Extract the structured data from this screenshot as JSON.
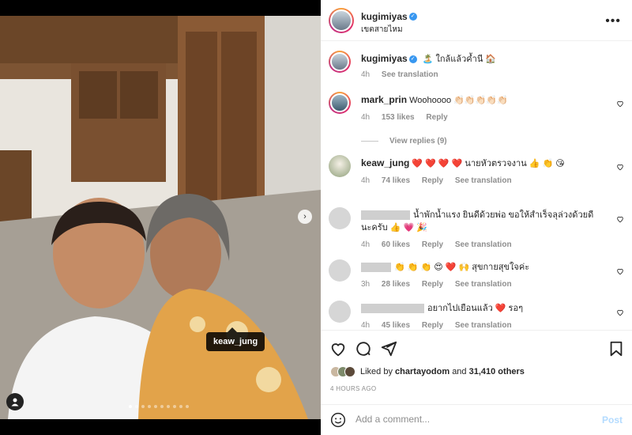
{
  "header": {
    "username": "kugimiyas",
    "location": "เขตสายไหม"
  },
  "caption": {
    "username": "kugimiyas",
    "text": "🏝️ ใกล้แล้วค้ำนี 🏠",
    "time": "4h",
    "translate": "See translation"
  },
  "comments": [
    {
      "username": "mark_prin",
      "text": "Woohoooo 👏🏻👏🏻👏🏻👏🏻👏🏻",
      "time": "4h",
      "likes": "153 likes",
      "reply": "Reply",
      "view_replies": "View replies (9)"
    },
    {
      "username": "keaw_jung",
      "text": "❤️ ❤️ ❤️ ❤️  นายหัวตรวจงาน 👍 👏 😘",
      "time": "4h",
      "likes": "74 likes",
      "reply": "Reply",
      "translate": "See translation"
    },
    {
      "username": "",
      "text": "น้ำพักน้ำแรง ยินดีด้วยพ่อ ขอให้สำเร็จลุล่วงด้วยดีนะครับ 👍 💗 🎉",
      "time": "4h",
      "likes": "60 likes",
      "reply": "Reply",
      "translate": "See translation"
    },
    {
      "username": "",
      "text": "👏 👏 👏 😍 ❤️ 🙌 สุขกายสุขใจค่ะ",
      "time": "3h",
      "likes": "28 likes",
      "reply": "Reply",
      "translate": "See translation"
    },
    {
      "username": "",
      "text": "อยากไปเยือนแล้ว ❤️ รอๆ",
      "time": "4h",
      "likes": "45 likes",
      "reply": "Reply",
      "translate": "See translation"
    }
  ],
  "media": {
    "tag_label": "keaw_jung",
    "slide_count": 10,
    "active_slide": 1
  },
  "likes": {
    "prefix": "Liked by",
    "user": "chartayodom",
    "and": "and",
    "others": "31,410 others"
  },
  "post_time": "4 HOURS AGO",
  "add_comment": {
    "placeholder": "Add a comment...",
    "post_label": "Post"
  },
  "colors": {
    "verified": "#3897f0",
    "heart_red": "#ed4956",
    "post_disabled": "#b3dbff"
  }
}
